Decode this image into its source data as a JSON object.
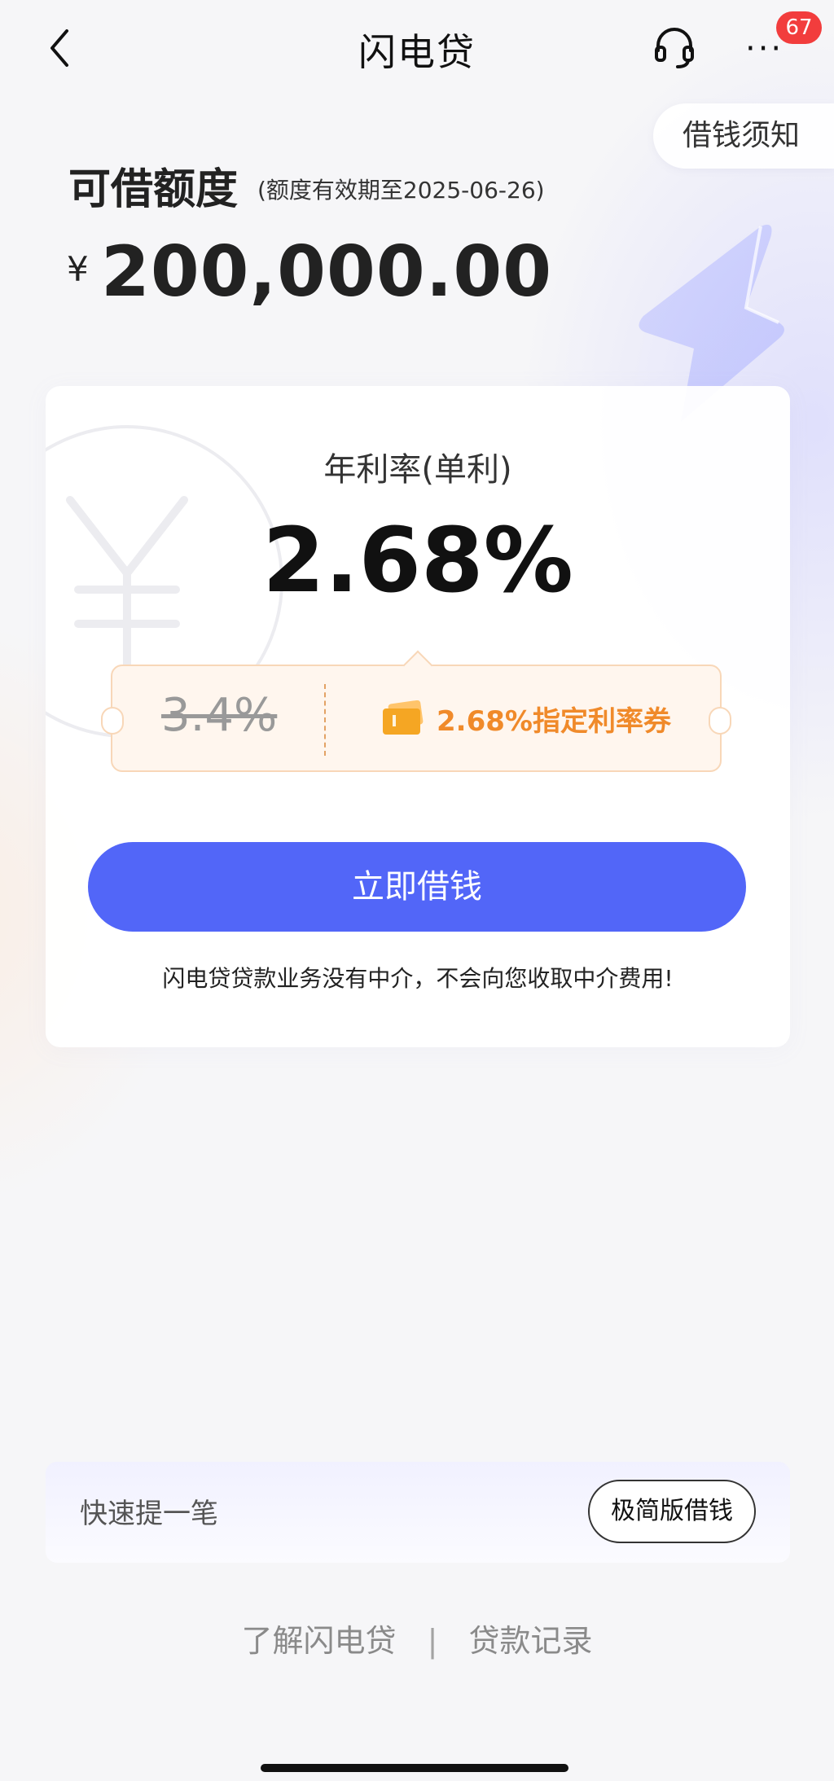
{
  "nav": {
    "title": "闪电贷",
    "badge_count": "67"
  },
  "notice": {
    "label": "借钱须知"
  },
  "credit": {
    "label": "可借额度",
    "expiry": "(额度有效期至2025-06-26)",
    "currency": "¥",
    "amount": "200,000.00"
  },
  "rate_card": {
    "label": "年利率(单利)",
    "value": "2.68%",
    "original_rate": "3.4%",
    "coupon_text": "2.68%指定利率券",
    "borrow_button": "立即借钱",
    "disclaimer": "闪电贷贷款业务没有中介，不会向您收取中介费用!"
  },
  "quick_bar": {
    "label": "快速提一笔",
    "button": "极简版借钱"
  },
  "footer": {
    "link_about": "了解闪电贷",
    "separator": "|",
    "link_records": "贷款记录"
  },
  "icons": {
    "back": "back-icon",
    "customer_service": "headset-icon",
    "more": "more-icon",
    "ticket": "ticket-icon",
    "bolt": "lightning-bolt-icon"
  },
  "colors": {
    "primary_button": "#5266f8",
    "coupon_text": "#f08a2a",
    "badge": "#f23d3d"
  }
}
